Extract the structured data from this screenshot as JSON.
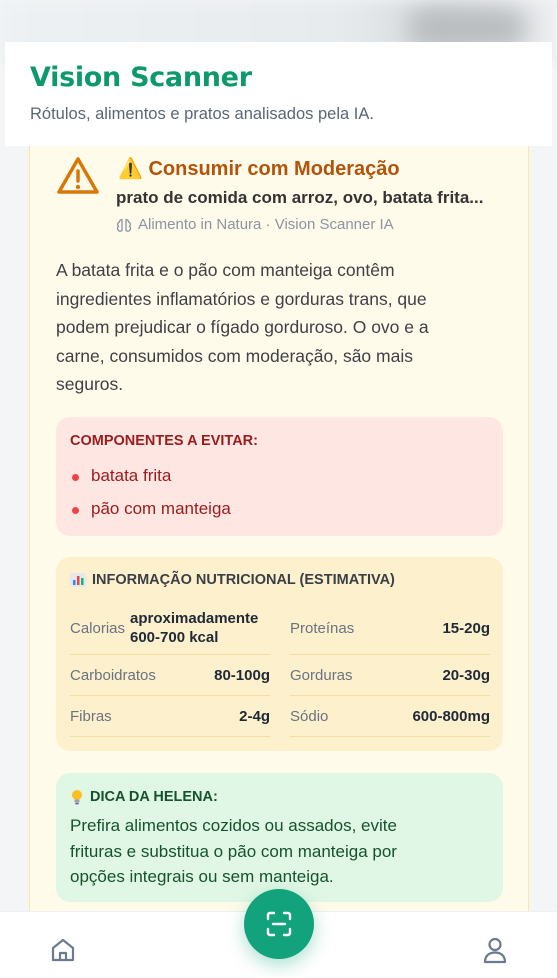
{
  "header": {
    "title": "Vision Scanner",
    "subtitle": "Rótulos, alimentos e pratos analisados pela IA."
  },
  "result": {
    "status_title": "⚠️ Consumir com Moderação",
    "status_color": "#b45309",
    "food_name": "prato de comida com arroz, ovo, batata frita...",
    "source_icon": "brain-icon",
    "source": "Alimento in Natura · Vision Scanner IA",
    "description": "A batata frita e o pão com manteiga contêm ingredientes inflamatórios e gorduras trans, que podem prejudicar o fígado gorduroso. O ovo e a carne, consumidos com moderação, são mais seguros."
  },
  "avoid": {
    "title": "COMPONENTES A EVITAR:",
    "items": [
      "batata frita",
      "pão com manteiga"
    ],
    "color": "#9b1c1c"
  },
  "nutrition": {
    "title": "INFORMAÇÃO NUTRICIONAL (ESTIMATIVA)",
    "icon": "bar-chart-icon",
    "rows": [
      [
        {
          "label": "Calorias",
          "value": "aproximadamente 600-700 kcal"
        },
        {
          "label": "Proteínas",
          "value": "15-20g"
        }
      ],
      [
        {
          "label": "Carboidratos",
          "value": "80-100g"
        },
        {
          "label": "Gorduras",
          "value": "20-30g"
        }
      ],
      [
        {
          "label": "Fibras",
          "value": "2-4g"
        },
        {
          "label": "Sódio",
          "value": "600-800mg"
        }
      ]
    ]
  },
  "tip": {
    "icon": "lightbulb-icon",
    "title": "DICA DA HELENA:",
    "text": "Prefira alimentos cozidos ou assados, evite frituras e substitua o pão com manteiga por opções integrais ou sem manteiga."
  },
  "nav": {
    "home_icon": "home-icon",
    "scan_icon": "scan-icon",
    "profile_icon": "user-icon",
    "accent": "#13a37c"
  }
}
